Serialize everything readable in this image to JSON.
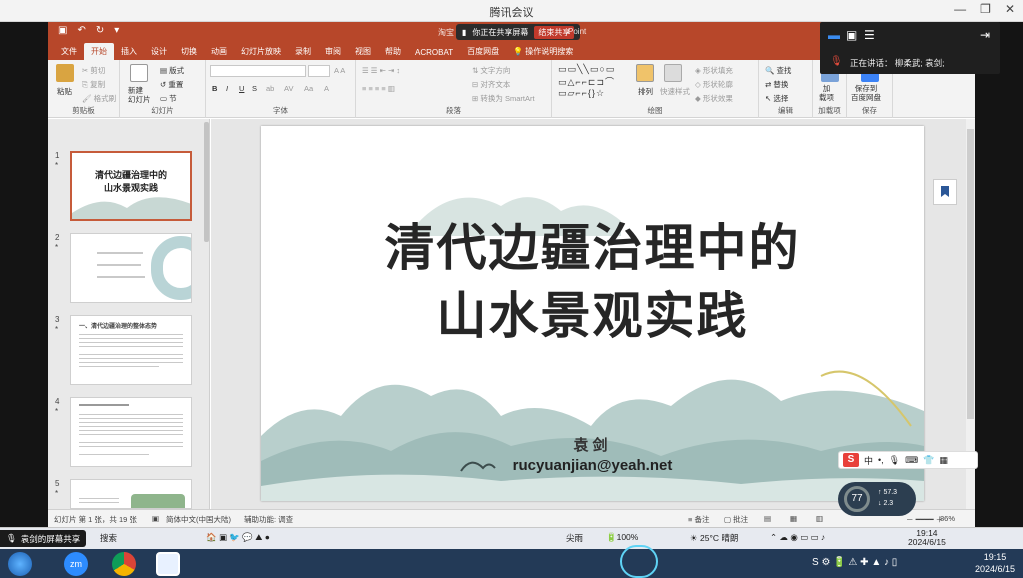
{
  "meeting": {
    "title": "腾讯会议",
    "share_status": "你正在共享屏幕",
    "stop_share": "结束共享",
    "speaking_label": "正在讲话：",
    "speaker": "柳柔武; 袁剑;",
    "share_tag": "袁剑的屏幕共享"
  },
  "ppt": {
    "title_left": "淘宝",
    "title_right": "Point",
    "tabs": [
      "文件",
      "开始",
      "插入",
      "设计",
      "切换",
      "动画",
      "幻灯片放映",
      "录制",
      "审阅",
      "视图",
      "帮助",
      "ACROBAT",
      "百度网盘",
      "操作说明搜索"
    ],
    "ribbon": {
      "clipboard": {
        "label": "剪贴板",
        "paste": "粘贴",
        "cut": "剪切",
        "copy": "复制",
        "format_painter": "格式刷"
      },
      "slides": {
        "label": "幻灯片",
        "new_slide": "新建\n幻灯片",
        "layout": "版式",
        "reset": "重置",
        "section": "节"
      },
      "font": {
        "label": "字体"
      },
      "paragraph": {
        "label": "段落",
        "text_dir": "文字方向",
        "align_text": "对齐文本",
        "smartart": "转换为 SmartArt"
      },
      "drawing": {
        "label": "绘图",
        "arrange": "排列",
        "quick_styles": "快速样式",
        "shape_fill": "形状填充",
        "shape_outline": "形状轮廓",
        "shape_effects": "形状效果"
      },
      "editing": {
        "label": "编辑",
        "find": "查找",
        "replace": "替换",
        "select": "选择"
      },
      "addins": {
        "label": "加载项",
        "add": "加\n载项"
      },
      "save": {
        "label": "保存",
        "save_to": "保存到\n百度网盘"
      }
    },
    "thumbnails": [
      {
        "num": "1",
        "title": "清代边疆治理中的\n山水景观实践"
      },
      {
        "num": "2",
        "title": ""
      },
      {
        "num": "3",
        "title": "一、清代边疆治理的整体态势"
      },
      {
        "num": "4",
        "title": ""
      },
      {
        "num": "5",
        "title": ""
      }
    ],
    "slide": {
      "title_line1": "清代边疆治理中的",
      "title_line2": "山水景观实践",
      "author": "袁剑",
      "email": "rucyuanjian@yeah.net"
    },
    "status": {
      "slide_info": "幻灯片 第 1 张，共 19 张",
      "language": "简体中文(中国大陆)",
      "accessibility": "辅助功能: 调查",
      "notes": "备注",
      "comments": "批注",
      "zoom": "86%"
    }
  },
  "system": {
    "ime": "中",
    "cpu_pct": "77",
    "net_up": "57.3",
    "net_down": "2.3",
    "inner_search": "搜索",
    "inner_weather": "25°C 晴朗",
    "inner_time": "19:14",
    "inner_date": "2024/6/15",
    "time": "19:15",
    "date": "2024/6/15",
    "inner_label": "尖雨",
    "battery": "100%"
  },
  "colors": {
    "ppt_accent": "#b7472a",
    "taskbar": "#233a57"
  }
}
